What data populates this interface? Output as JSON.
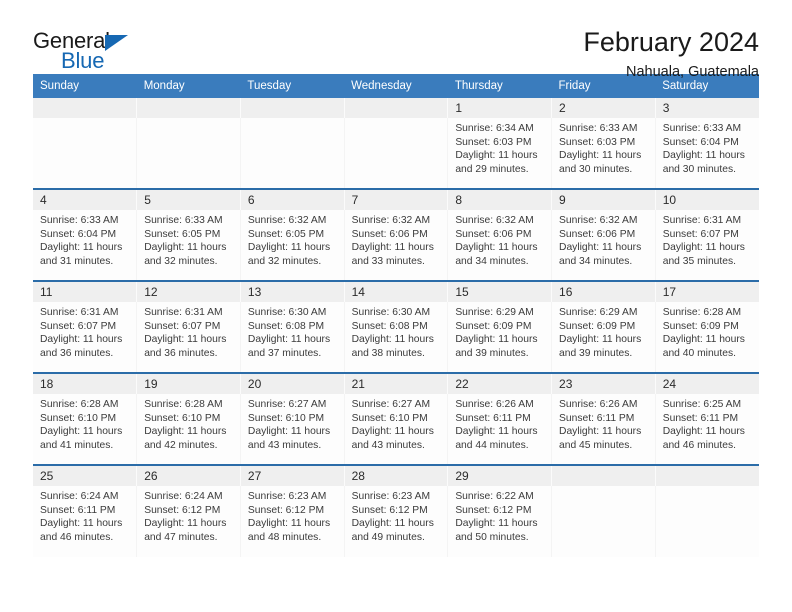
{
  "logo": {
    "word_top": "General",
    "word_bottom": "Blue",
    "triangle_color": "#1668b3",
    "text_color": "#1a1a1a"
  },
  "header": {
    "title": "February 2024",
    "location": "Nahuala, Guatemala"
  },
  "theme": {
    "header_bar": "#3a7cbd",
    "row_divider": "#2b6ca8",
    "daynum_band": "#efefef",
    "cell_background": "#fdfdfd",
    "text": "#3b3b3b"
  },
  "weekdays": [
    "Sunday",
    "Monday",
    "Tuesday",
    "Wednesday",
    "Thursday",
    "Friday",
    "Saturday"
  ],
  "weeks": [
    [
      {
        "day": ""
      },
      {
        "day": ""
      },
      {
        "day": ""
      },
      {
        "day": ""
      },
      {
        "day": "1",
        "sunrise": "Sunrise: 6:34 AM",
        "sunset": "Sunset: 6:03 PM",
        "daylight1": "Daylight: 11 hours",
        "daylight2": "and 29 minutes."
      },
      {
        "day": "2",
        "sunrise": "Sunrise: 6:33 AM",
        "sunset": "Sunset: 6:03 PM",
        "daylight1": "Daylight: 11 hours",
        "daylight2": "and 30 minutes."
      },
      {
        "day": "3",
        "sunrise": "Sunrise: 6:33 AM",
        "sunset": "Sunset: 6:04 PM",
        "daylight1": "Daylight: 11 hours",
        "daylight2": "and 30 minutes."
      }
    ],
    [
      {
        "day": "4",
        "sunrise": "Sunrise: 6:33 AM",
        "sunset": "Sunset: 6:04 PM",
        "daylight1": "Daylight: 11 hours",
        "daylight2": "and 31 minutes."
      },
      {
        "day": "5",
        "sunrise": "Sunrise: 6:33 AM",
        "sunset": "Sunset: 6:05 PM",
        "daylight1": "Daylight: 11 hours",
        "daylight2": "and 32 minutes."
      },
      {
        "day": "6",
        "sunrise": "Sunrise: 6:32 AM",
        "sunset": "Sunset: 6:05 PM",
        "daylight1": "Daylight: 11 hours",
        "daylight2": "and 32 minutes."
      },
      {
        "day": "7",
        "sunrise": "Sunrise: 6:32 AM",
        "sunset": "Sunset: 6:06 PM",
        "daylight1": "Daylight: 11 hours",
        "daylight2": "and 33 minutes."
      },
      {
        "day": "8",
        "sunrise": "Sunrise: 6:32 AM",
        "sunset": "Sunset: 6:06 PM",
        "daylight1": "Daylight: 11 hours",
        "daylight2": "and 34 minutes."
      },
      {
        "day": "9",
        "sunrise": "Sunrise: 6:32 AM",
        "sunset": "Sunset: 6:06 PM",
        "daylight1": "Daylight: 11 hours",
        "daylight2": "and 34 minutes."
      },
      {
        "day": "10",
        "sunrise": "Sunrise: 6:31 AM",
        "sunset": "Sunset: 6:07 PM",
        "daylight1": "Daylight: 11 hours",
        "daylight2": "and 35 minutes."
      }
    ],
    [
      {
        "day": "11",
        "sunrise": "Sunrise: 6:31 AM",
        "sunset": "Sunset: 6:07 PM",
        "daylight1": "Daylight: 11 hours",
        "daylight2": "and 36 minutes."
      },
      {
        "day": "12",
        "sunrise": "Sunrise: 6:31 AM",
        "sunset": "Sunset: 6:07 PM",
        "daylight1": "Daylight: 11 hours",
        "daylight2": "and 36 minutes."
      },
      {
        "day": "13",
        "sunrise": "Sunrise: 6:30 AM",
        "sunset": "Sunset: 6:08 PM",
        "daylight1": "Daylight: 11 hours",
        "daylight2": "and 37 minutes."
      },
      {
        "day": "14",
        "sunrise": "Sunrise: 6:30 AM",
        "sunset": "Sunset: 6:08 PM",
        "daylight1": "Daylight: 11 hours",
        "daylight2": "and 38 minutes."
      },
      {
        "day": "15",
        "sunrise": "Sunrise: 6:29 AM",
        "sunset": "Sunset: 6:09 PM",
        "daylight1": "Daylight: 11 hours",
        "daylight2": "and 39 minutes."
      },
      {
        "day": "16",
        "sunrise": "Sunrise: 6:29 AM",
        "sunset": "Sunset: 6:09 PM",
        "daylight1": "Daylight: 11 hours",
        "daylight2": "and 39 minutes."
      },
      {
        "day": "17",
        "sunrise": "Sunrise: 6:28 AM",
        "sunset": "Sunset: 6:09 PM",
        "daylight1": "Daylight: 11 hours",
        "daylight2": "and 40 minutes."
      }
    ],
    [
      {
        "day": "18",
        "sunrise": "Sunrise: 6:28 AM",
        "sunset": "Sunset: 6:10 PM",
        "daylight1": "Daylight: 11 hours",
        "daylight2": "and 41 minutes."
      },
      {
        "day": "19",
        "sunrise": "Sunrise: 6:28 AM",
        "sunset": "Sunset: 6:10 PM",
        "daylight1": "Daylight: 11 hours",
        "daylight2": "and 42 minutes."
      },
      {
        "day": "20",
        "sunrise": "Sunrise: 6:27 AM",
        "sunset": "Sunset: 6:10 PM",
        "daylight1": "Daylight: 11 hours",
        "daylight2": "and 43 minutes."
      },
      {
        "day": "21",
        "sunrise": "Sunrise: 6:27 AM",
        "sunset": "Sunset: 6:10 PM",
        "daylight1": "Daylight: 11 hours",
        "daylight2": "and 43 minutes."
      },
      {
        "day": "22",
        "sunrise": "Sunrise: 6:26 AM",
        "sunset": "Sunset: 6:11 PM",
        "daylight1": "Daylight: 11 hours",
        "daylight2": "and 44 minutes."
      },
      {
        "day": "23",
        "sunrise": "Sunrise: 6:26 AM",
        "sunset": "Sunset: 6:11 PM",
        "daylight1": "Daylight: 11 hours",
        "daylight2": "and 45 minutes."
      },
      {
        "day": "24",
        "sunrise": "Sunrise: 6:25 AM",
        "sunset": "Sunset: 6:11 PM",
        "daylight1": "Daylight: 11 hours",
        "daylight2": "and 46 minutes."
      }
    ],
    [
      {
        "day": "25",
        "sunrise": "Sunrise: 6:24 AM",
        "sunset": "Sunset: 6:11 PM",
        "daylight1": "Daylight: 11 hours",
        "daylight2": "and 46 minutes."
      },
      {
        "day": "26",
        "sunrise": "Sunrise: 6:24 AM",
        "sunset": "Sunset: 6:12 PM",
        "daylight1": "Daylight: 11 hours",
        "daylight2": "and 47 minutes."
      },
      {
        "day": "27",
        "sunrise": "Sunrise: 6:23 AM",
        "sunset": "Sunset: 6:12 PM",
        "daylight1": "Daylight: 11 hours",
        "daylight2": "and 48 minutes."
      },
      {
        "day": "28",
        "sunrise": "Sunrise: 6:23 AM",
        "sunset": "Sunset: 6:12 PM",
        "daylight1": "Daylight: 11 hours",
        "daylight2": "and 49 minutes."
      },
      {
        "day": "29",
        "sunrise": "Sunrise: 6:22 AM",
        "sunset": "Sunset: 6:12 PM",
        "daylight1": "Daylight: 11 hours",
        "daylight2": "and 50 minutes."
      },
      {
        "day": ""
      },
      {
        "day": ""
      }
    ]
  ]
}
